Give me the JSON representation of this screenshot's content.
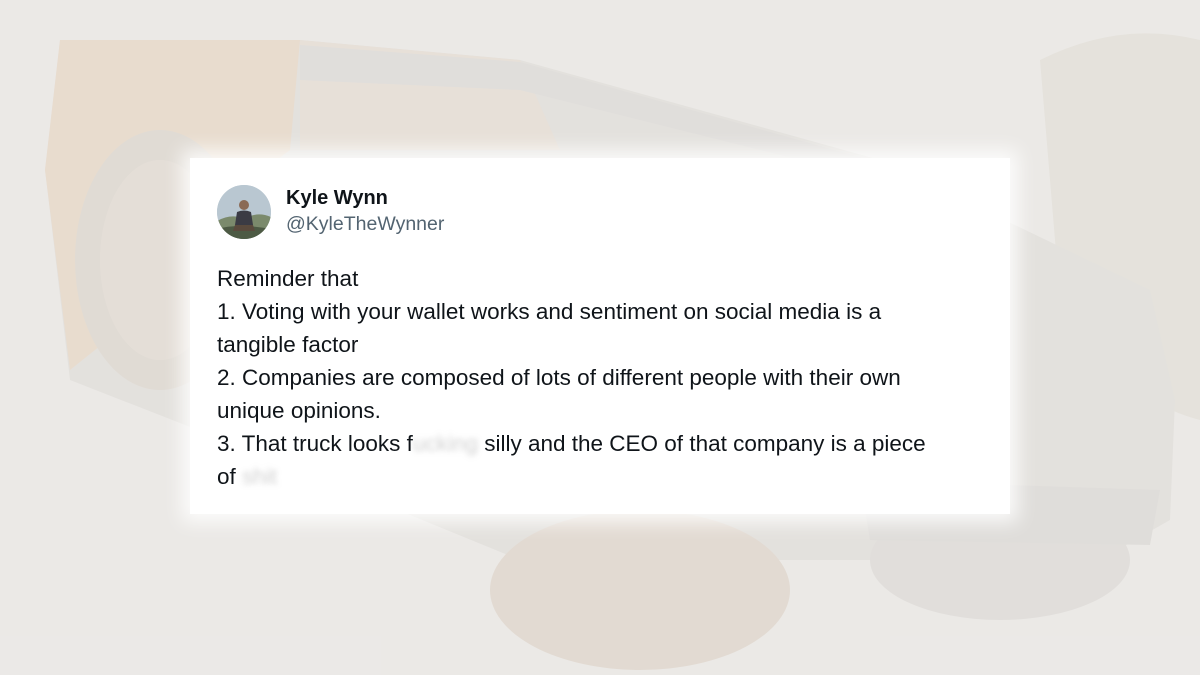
{
  "tweet": {
    "author": {
      "display_name": "Kyle Wynn",
      "handle": "@KyleTheWynner",
      "avatar_icon": "profile-photo"
    },
    "lines": [
      {
        "parts": [
          {
            "text": "Reminder that",
            "censored": false
          }
        ]
      },
      {
        "parts": [
          {
            "text": "1. Voting with your wallet works and sentiment on social media is a",
            "censored": false
          }
        ]
      },
      {
        "parts": [
          {
            "text": "tangible factor",
            "censored": false
          }
        ]
      },
      {
        "parts": [
          {
            "text": "2. Companies are composed of lots of different people with their own",
            "censored": false
          }
        ]
      },
      {
        "parts": [
          {
            "text": "unique opinions.",
            "censored": false
          }
        ]
      },
      {
        "parts": [
          {
            "text": "3. That truck looks f",
            "censored": false
          },
          {
            "text": "ucking",
            "censored": true
          },
          {
            "text": " silly and the CEO of that company is a piece",
            "censored": false
          }
        ]
      },
      {
        "parts": [
          {
            "text": "of ",
            "censored": false
          },
          {
            "text": "shit",
            "censored": true
          }
        ]
      }
    ]
  },
  "colors": {
    "card_background": "#ffffff",
    "text_primary": "#0f1419",
    "text_secondary": "#536471",
    "page_background": "#e6e4e2"
  }
}
